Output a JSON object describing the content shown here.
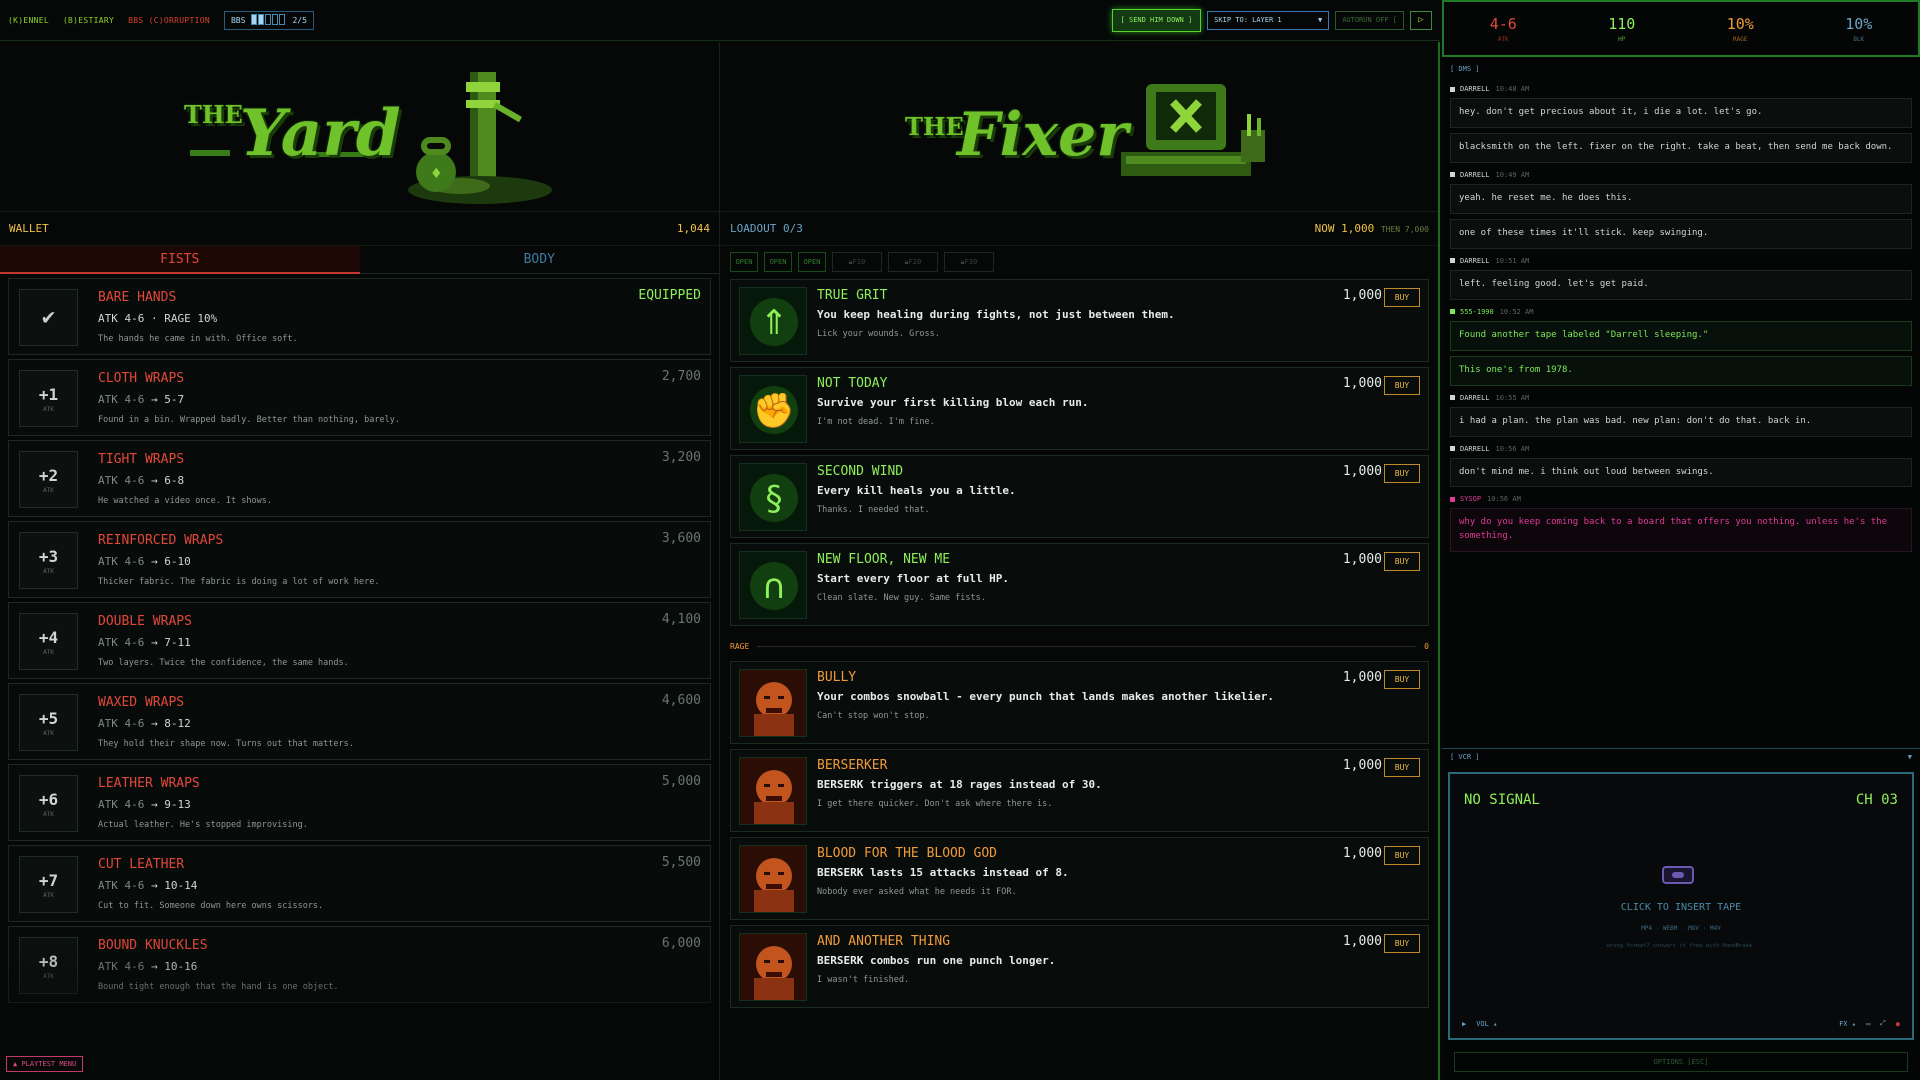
{
  "topbar": {
    "menu": [
      "(K)ENNEL",
      "(B)ESTIARY",
      "BBS (C)ORRUPTION"
    ],
    "bbs_label": "BBS",
    "bbs_progress": "2/5",
    "bbs_fill": 0.4,
    "send_button": "[ SEND HIM DOWN ]",
    "skip_label": "SKIP TO: LAYER 1",
    "autorun": "AUTORUN OFF [",
    "play_icon": "play-icon"
  },
  "yard": {
    "banner_the": "THE",
    "banner_title": "Yard",
    "wallet_label": "WALLET",
    "wallet_value": "1,044",
    "tabs": [
      "FISTS",
      "BODY"
    ],
    "items": [
      {
        "icon": "check",
        "name": "BARE HANDS",
        "stat_old": "",
        "stat": "ATK 4-6 · RAGE 10%",
        "desc": "The hands he came in with. Office soft.",
        "price": "EQUIPPED",
        "equipped": true
      },
      {
        "icon": "+1",
        "name": "CLOTH WRAPS",
        "stat_old": "ATK 4-6",
        "stat": " → 5-7",
        "desc": "Found in a bin. Wrapped badly. Better than nothing, barely.",
        "price": "2,700"
      },
      {
        "icon": "+2",
        "name": "TIGHT WRAPS",
        "stat_old": "ATK 4-6",
        "stat": " → 6-8",
        "desc": "He watched a video once. It shows.",
        "price": "3,200"
      },
      {
        "icon": "+3",
        "name": "REINFORCED WRAPS",
        "stat_old": "ATK 4-6",
        "stat": " → 6-10",
        "desc": "Thicker fabric. The fabric is doing a lot of work here.",
        "price": "3,600"
      },
      {
        "icon": "+4",
        "name": "DOUBLE WRAPS",
        "stat_old": "ATK 4-6",
        "stat": " → 7-11",
        "desc": "Two layers. Twice the confidence, the same hands.",
        "price": "4,100"
      },
      {
        "icon": "+5",
        "name": "WAXED WRAPS",
        "stat_old": "ATK 4-6",
        "stat": " → 8-12",
        "desc": "They hold their shape now. Turns out that matters.",
        "price": "4,600"
      },
      {
        "icon": "+6",
        "name": "LEATHER WRAPS",
        "stat_old": "ATK 4-6",
        "stat": " → 9-13",
        "desc": "Actual leather. He's stopped improvising.",
        "price": "5,000"
      },
      {
        "icon": "+7",
        "name": "CUT LEATHER",
        "stat_old": "ATK 4-6",
        "stat": " → 10-14",
        "desc": "Cut to fit. Someone down here owns scissors.",
        "price": "5,500"
      },
      {
        "icon": "+8",
        "name": "BOUND KNUCKLES",
        "stat_old": "ATK 4-6",
        "stat": " → 10-16",
        "desc": "Bound tight enough that the hand is one object.",
        "price": "6,000"
      }
    ],
    "atk_small": "ATK"
  },
  "fixer": {
    "banner_the": "THE",
    "banner_title": "Fixer",
    "loadout_label": "LOADOUT 0/3",
    "now_label": "NOW",
    "now_value": "1,000",
    "then_label": "THEN 7,000",
    "slots": [
      "OPEN",
      "OPEN",
      "OPEN",
      "F10",
      "F20",
      "F30"
    ],
    "rage_section": "RAGE",
    "rage_count": "0",
    "buy_label": "BUY",
    "mods": [
      {
        "name": "TRUE GRIT",
        "effect": "You keep healing during fights, not just between them.",
        "flavor": "Lick your wounds. Gross.",
        "price": "1,000",
        "kind": "g",
        "art": "arrows"
      },
      {
        "name": "NOT TODAY",
        "effect": "Survive your first killing blow each run.",
        "flavor": "I'm not dead. I'm fine.",
        "price": "1,000",
        "kind": "g",
        "art": "fist"
      },
      {
        "name": "SECOND WIND",
        "effect": "Every kill heals you a little.",
        "flavor": "Thanks. I needed that.",
        "price": "1,000",
        "kind": "g",
        "art": "wind"
      },
      {
        "name": "NEW FLOOR, NEW ME",
        "effect": "Start every floor at full HP.",
        "flavor": "Clean slate. New guy. Same fists.",
        "price": "1,000",
        "kind": "g",
        "art": "door"
      }
    ],
    "rage_mods": [
      {
        "name": "BULLY",
        "effect": "Your combos snowball - every punch that lands makes another likelier.",
        "flavor": "Can't stop won't stop.",
        "price": "1,000",
        "kind": "r"
      },
      {
        "name": "BERSERKER",
        "effect": "BERSERK triggers at 18 rages instead of 30.",
        "flavor": "I get there quicker. Don't ask where there is.",
        "price": "1,000",
        "kind": "r"
      },
      {
        "name": "BLOOD FOR THE BLOOD GOD",
        "effect": "BERSERK lasts 15 attacks instead of 8.",
        "flavor": "Nobody ever asked what he needs it FOR.",
        "price": "1,000",
        "kind": "r"
      },
      {
        "name": "AND ANOTHER THING",
        "effect": "BERSERK combos run one punch longer.",
        "flavor": "I wasn't finished.",
        "price": "1,000",
        "kind": "r"
      }
    ]
  },
  "stats": [
    {
      "value": "4-6",
      "label": "ATK",
      "color": "#e2483a"
    },
    {
      "value": "110",
      "label": "HP",
      "color": "#8ef05a"
    },
    {
      "value": "10%",
      "label": "RAGE",
      "color": "#f09a3a"
    },
    {
      "value": "10%",
      "label": "BLK",
      "color": "#6ba3c8"
    }
  ],
  "dms": {
    "header": "[ DMS ]",
    "messages": [
      {
        "sender": "DARRELL",
        "time": "10:48 AM",
        "kind": "",
        "lines": [
          "hey. don't get precious about it, i die a lot. let's go.",
          "blacksmith on the left. fixer on the right. take a beat, then send me back down."
        ]
      },
      {
        "sender": "DARRELL",
        "time": "10:49 AM",
        "kind": "",
        "lines": [
          "yeah. he reset me. he does this.",
          "one of these times it'll stick. keep swinging."
        ]
      },
      {
        "sender": "DARRELL",
        "time": "10:51 AM",
        "kind": "",
        "lines": [
          "left. feeling good. let's get paid."
        ]
      },
      {
        "sender": "555-1990",
        "time": "10:52 AM",
        "kind": "g",
        "lines": [
          "Found another tape labeled \"Darrell sleeping.\"",
          "This one's from 1978."
        ]
      },
      {
        "sender": "DARRELL",
        "time": "10:55 AM",
        "kind": "",
        "lines": [
          "i had a plan. the plan was bad. new plan: don't do that. back in."
        ]
      },
      {
        "sender": "DARRELL",
        "time": "10:56 AM",
        "kind": "",
        "lines": [
          "don't mind me. i think out loud between swings."
        ]
      },
      {
        "sender": "SYSOP",
        "time": "10:56 AM",
        "kind": "p",
        "lines": [
          "why do you keep coming back to a board that offers you nothing. unless he's the something."
        ]
      }
    ]
  },
  "vcr": {
    "header": "[ VCR ]",
    "collapse_icon": "triangle-down-icon",
    "no_signal": "NO SIGNAL",
    "channel": "CH 03",
    "insert": "CLICK TO INSERT TAPE",
    "formats": "MP4 · WEBM · MOV · M4V",
    "hint": "wrong format? convert it free with HandBrake.",
    "vol": "VOL ▴",
    "fx": "FX ▴"
  },
  "options": "OPTIONS [ESC]",
  "playtest": "▲ PLAYTEST MENU"
}
